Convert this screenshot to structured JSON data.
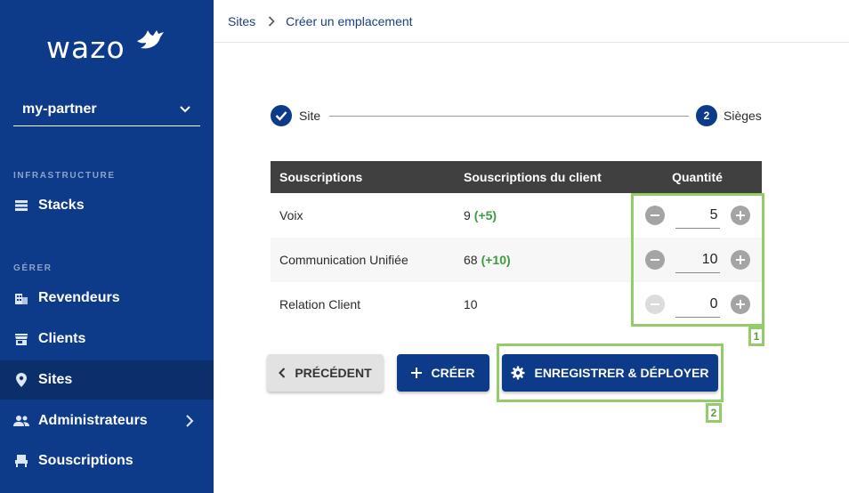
{
  "brand": {
    "logo_text": "wazo"
  },
  "sidebar": {
    "tenant": "my-partner",
    "sections": [
      {
        "title": "INFRASTRUCTURE"
      },
      {
        "title": "GÉRER"
      }
    ],
    "items": [
      {
        "label": "Stacks",
        "icon": "stacks-icon"
      },
      {
        "label": "Revendeurs",
        "icon": "building-icon"
      },
      {
        "label": "Clients",
        "icon": "store-icon"
      },
      {
        "label": "Sites",
        "icon": "location-pin-icon",
        "active": true
      },
      {
        "label": "Administrateurs",
        "icon": "people-icon"
      },
      {
        "label": "Souscriptions",
        "icon": "subscriptions-icon"
      }
    ]
  },
  "breadcrumb": {
    "parent": "Sites",
    "current": "Créer un emplacement"
  },
  "stepper": {
    "steps": [
      {
        "label": "Site",
        "status": "done"
      },
      {
        "number": "2",
        "label": "Sièges",
        "status": "active"
      }
    ]
  },
  "table": {
    "headers": [
      "Souscriptions",
      "Souscriptions du client",
      "Quantité"
    ],
    "rows": [
      {
        "name": "Voix",
        "client_subs": "9",
        "delta": "(+5)",
        "quantity": "5"
      },
      {
        "name": "Communication Unifiée",
        "client_subs": "68",
        "delta": "(+10)",
        "quantity": "10"
      },
      {
        "name": "Relation Client",
        "client_subs": "10",
        "delta": "",
        "quantity": "0"
      }
    ]
  },
  "annotations": [
    "1",
    "2"
  ],
  "buttons": {
    "previous": "PRÉCÉDENT",
    "create": "CRÉER",
    "save_deploy": "ENREGISTRER & DÉPLOYER"
  },
  "colors": {
    "sidebar": "#0d3b8a",
    "accent": "#0d3b8a",
    "positive": "#3c9a3f",
    "annotation": "#92cd6a"
  }
}
